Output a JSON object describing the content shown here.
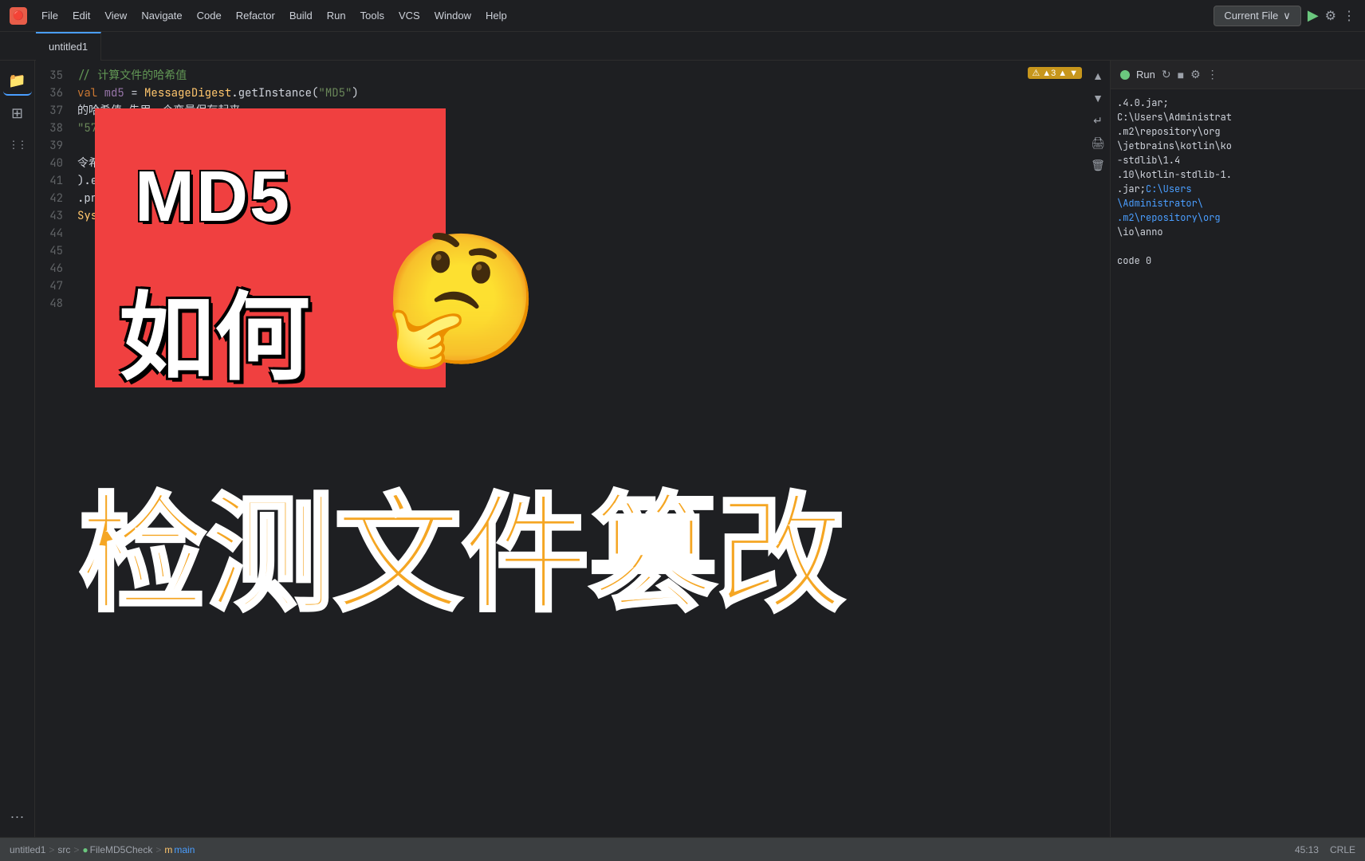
{
  "app": {
    "icon": "🔴",
    "title": "untitled1"
  },
  "titlebar": {
    "menu_items": [
      "File",
      "Edit",
      "View",
      "Navigate",
      "Code",
      "Refactor",
      "Build",
      "Run",
      "Tools",
      "VCS",
      "Window",
      "Help"
    ],
    "current_file_label": "Current File",
    "chevron": "∨",
    "run_icon": "▶",
    "gear_icon": "⚙",
    "dots_icon": "⋮"
  },
  "tabs": [
    {
      "label": "untitled1",
      "active": true
    }
  ],
  "sidebar": {
    "icons": [
      {
        "name": "folder-icon",
        "glyph": "📁"
      },
      {
        "name": "structure-icon",
        "glyph": "⊞"
      },
      {
        "name": "layers-icon",
        "glyph": "⋮⋮"
      },
      {
        "name": "more-icon",
        "glyph": "..."
      }
    ]
  },
  "editor": {
    "warning_count": "▲3",
    "lines": [
      {
        "num": "3",
        "content": ""
      },
      {
        "num": "3",
        "content": ""
      },
      {
        "num": "3",
        "content": "的哈希值  先用一个变量保存起来"
      },
      {
        "num": "3",
        "content": "\"5763f0c29286c4e83a102c876874a"
      },
      {
        "num": "",
        "content": ""
      },
      {
        "num": "3",
        "content": ""
      },
      {
        "num": "",
        "content": ""
      },
      {
        "num": "3",
        "content": "令希值与已知的哈希值"
      },
      {
        "num": "4",
        "content": "    ).equals(h"
      },
      {
        "num": "",
        "content": "    .println(\""
      },
      {
        "num": "41",
        "content": ""
      },
      {
        "num": "42",
        "content": "    System.out.println(\"文件篡改!\");"
      },
      {
        "num": "43",
        "content": ""
      },
      {
        "num": "44",
        "content": ""
      },
      {
        "num": "45",
        "content": ""
      },
      {
        "num": "46",
        "content": ""
      },
      {
        "num": "47",
        "content": ""
      },
      {
        "num": "48",
        "content": ""
      }
    ]
  },
  "thumbnail": {
    "md5_text": "MD5",
    "ruhe_text": "如何",
    "emoji": "🤔",
    "bottom_text": "检测文件篡改"
  },
  "right_panel": {
    "run_label": "Run",
    "lines": [
      ".4.0.jar;",
      "C:\\Users\\Administrat",
      ".m2\\repository\\org",
      "\\jetbrains\\kotlin\\ko",
      "-stdlib\\1.4",
      ".10\\kotlin-stdlib-1.",
      ".jar;",
      "C:\\Users",
      "\\Administrator\\",
      ".m2\\repository\\org",
      "\\io\\anno",
      "",
      "code 0"
    ],
    "link_segments": [
      "C:\\Users",
      "\\Administrator\\",
      ".m2\\repository\\org"
    ]
  },
  "bottombar": {
    "project": "untitled1",
    "sep1": ">",
    "src": "src",
    "sep2": ">",
    "file": "FileMD5Check",
    "sep3": ">",
    "fn": "main",
    "position": "45:13",
    "encoding": "CRLE"
  }
}
